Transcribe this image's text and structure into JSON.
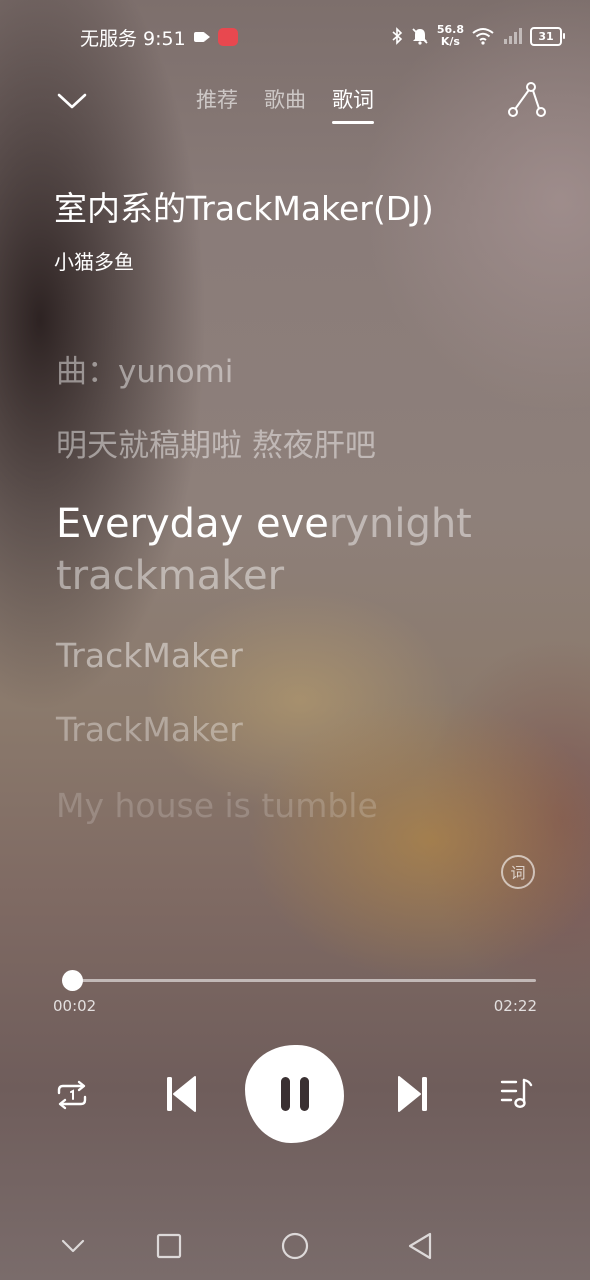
{
  "status_bar": {
    "carrier_time": "无服务 9:51",
    "speed_value": "56.8",
    "speed_unit": "K/s",
    "battery": "31",
    "icons": [
      "video-icon",
      "app-notification-icon",
      "bluetooth-icon",
      "mute-bell-icon",
      "wifi-icon",
      "signal-icon",
      "battery-icon"
    ]
  },
  "nav": {
    "tabs": [
      {
        "label": "推荐"
      },
      {
        "label": "歌曲"
      },
      {
        "label": "歌词"
      }
    ],
    "active_tab": "歌词"
  },
  "song": {
    "title": "室内系的TrackMaker(DJ)",
    "artist": "小猫多鱼"
  },
  "lyrics": {
    "lines": [
      "曲：yunomi",
      "明天就稿期啦 熬夜肝吧",
      "Everyday everynight trackmaker",
      "TrackMaker",
      "TrackMaker",
      "My house is tumble"
    ],
    "current_sung": "Everyday eve",
    "current_unsung": "rynight trackmaker"
  },
  "lyric_toggle_label": "词",
  "player": {
    "current_time": "00:02",
    "total_time": "02:22",
    "progress": 0.014
  },
  "colors": {
    "foreground": "#ffffff",
    "background_dark": "#7d6f6c",
    "background_warm": "#be8c3c"
  }
}
